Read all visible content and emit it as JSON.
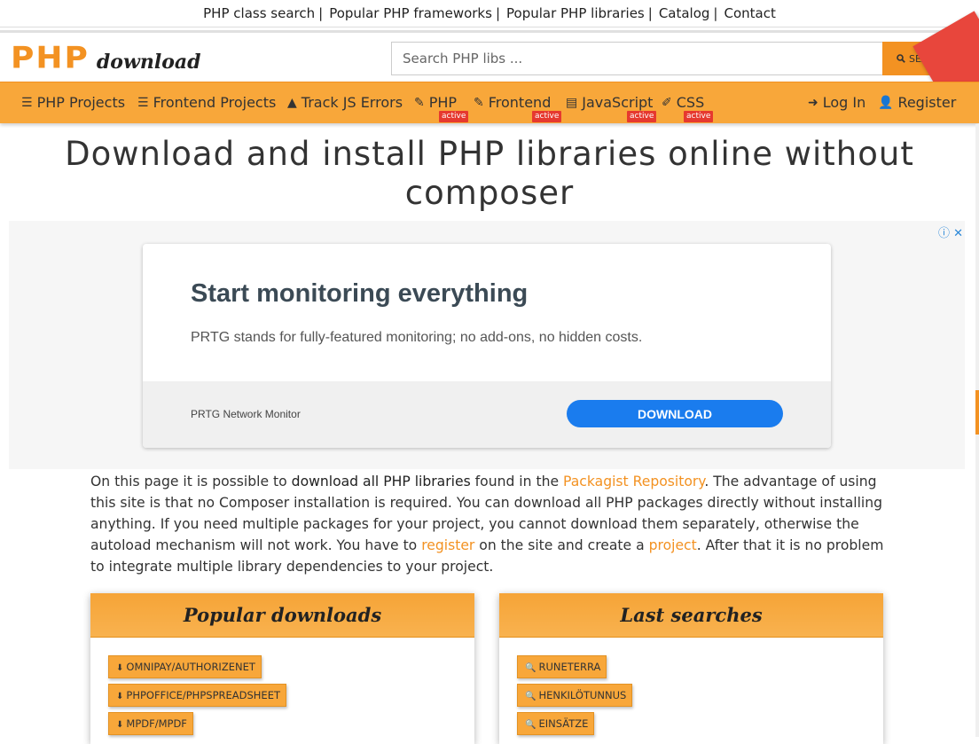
{
  "toplinks": [
    {
      "label": "PHP class search"
    },
    {
      "label": "Popular PHP frameworks"
    },
    {
      "label": "Popular PHP libraries"
    },
    {
      "label": "Catalog"
    },
    {
      "label": "Contact"
    }
  ],
  "logo": {
    "php": "PHP",
    "download": "download"
  },
  "search": {
    "placeholder": "Search PHP libs ...",
    "button_label": "SEARCH",
    "icon": "search-icon"
  },
  "nav": {
    "items": [
      {
        "label": "PHP Projects",
        "icon": "list-icon"
      },
      {
        "label": "Frontend Projects",
        "icon": "list-icon"
      },
      {
        "label": "Track JS Errors",
        "icon": "warning-icon"
      },
      {
        "label": "PHP",
        "icon": "edit-icon",
        "badge": "active"
      },
      {
        "label": "Frontend",
        "icon": "edit-icon",
        "badge": "active"
      },
      {
        "label": "JavaScript",
        "icon": "code-file-icon",
        "badge": "active"
      },
      {
        "label": "CSS",
        "icon": "brush-icon",
        "badge": "active"
      }
    ],
    "login": "Log In",
    "register": "Register"
  },
  "page_title": "Download and install PHP libraries online without composer",
  "ad": {
    "headline": "Start monitoring everything",
    "text": "PRTG stands for fully-featured monitoring; no add-ons, no hidden costs.",
    "brand": "PRTG Network Monitor",
    "button": "DOWNLOAD",
    "info_icon": "ⓘ",
    "close_icon": "✕"
  },
  "intro": {
    "p1": "On this page it is possible to ",
    "bold1": "download all PHP libraries",
    "p2": " found in the ",
    "link1": "Packagist Repository",
    "p3": ". The advantage of using this site is that no Composer installation is required. You can download all PHP packages directly without installing anything. If you need multiple packages for your project, you cannot download them separately, otherwise the autoload mechanism will not work. You have to ",
    "link2": "register",
    "p4": " on the site and create a ",
    "link3": "project",
    "p5": ". After that it is no problem to integrate multiple library dependencies to your project."
  },
  "popular": {
    "title": "Popular downloads",
    "items": [
      "OMNIPAY/AUTHORIZENET",
      "PHPOFFICE/PHPSPREADSHEET",
      "MPDF/MPDF"
    ]
  },
  "searches": {
    "title": "Last searches",
    "items": [
      "RUNETERRA",
      "HENKILÖTUNNUS",
      "EINSÄTZE"
    ]
  },
  "colors": {
    "accent": "#f39222",
    "nav_bg": "#f8a73a",
    "badge": "#e6392f",
    "ad_button": "#1a7cee"
  }
}
